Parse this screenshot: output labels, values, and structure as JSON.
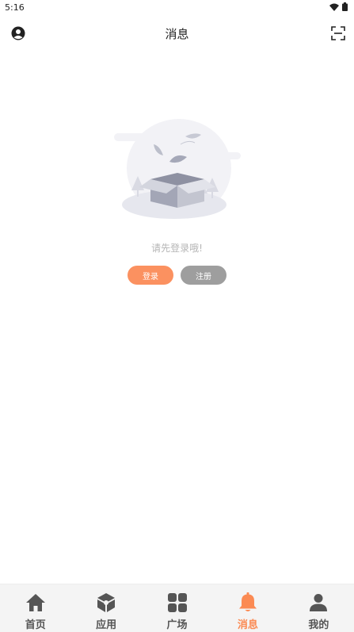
{
  "status_bar": {
    "time": "5:16"
  },
  "header": {
    "title": "消息"
  },
  "empty_state": {
    "message": "请先登录哦!",
    "login_label": "登录",
    "register_label": "注册"
  },
  "bottom_nav": {
    "items": [
      {
        "label": "首页",
        "icon": "home-icon"
      },
      {
        "label": "应用",
        "icon": "apps-cube-icon"
      },
      {
        "label": "广场",
        "icon": "grid-icon"
      },
      {
        "label": "消息",
        "icon": "bell-icon",
        "active": true
      },
      {
        "label": "我的",
        "icon": "person-icon"
      }
    ]
  },
  "colors": {
    "accent": "#fb8a53",
    "login_button": "#fb9160",
    "register_button": "#9e9e9e",
    "nav_icon": "#555555"
  }
}
